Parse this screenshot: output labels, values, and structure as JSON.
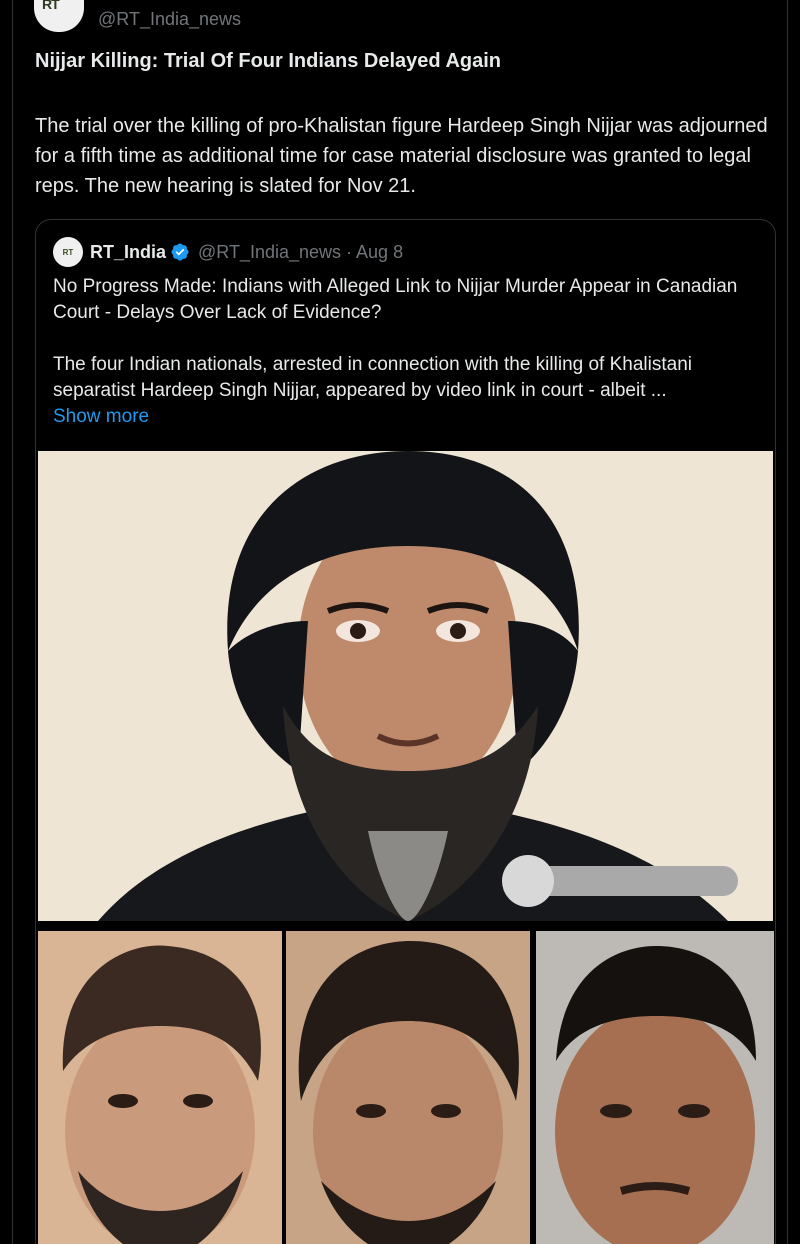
{
  "post": {
    "handle": "@RT_India_news",
    "avatar_text": "RT",
    "title": "Nijjar Killing: Trial Of Four Indians Delayed Again",
    "body": "The trial over the killing of pro-Khalistan figure Hardeep Singh Nijjar was adjourned for a fifth time as additional time for case material disclosure was granted to legal reps. The new hearing is slated for Nov 21."
  },
  "quote": {
    "avatar_text": "RT",
    "name": "RT_India",
    "handle_date": "@RT_India_news · Aug 8",
    "title": "No Progress Made: Indians with Alleged Link to Nijjar Murder Appear in Canadian Court - Delays Over Lack of Evidence?",
    "body": "The four Indian nationals, arrested in connection with the killing of Khalistani separatist Hardeep Singh Nijjar, appeared by video link in court - albeit  ...",
    "show_more": "Show more"
  },
  "colors": {
    "background": "#000000",
    "text": "#e7e9ea",
    "muted": "#71767b",
    "link": "#1d9bf0",
    "border": "#2f3336",
    "verified": "#1d9bf0"
  },
  "media": {
    "main_photo": "man-in-black-turban-with-beard-photo",
    "small_photos": [
      "suspect-photo-1",
      "suspect-photo-2",
      "suspect-photo-3"
    ]
  }
}
